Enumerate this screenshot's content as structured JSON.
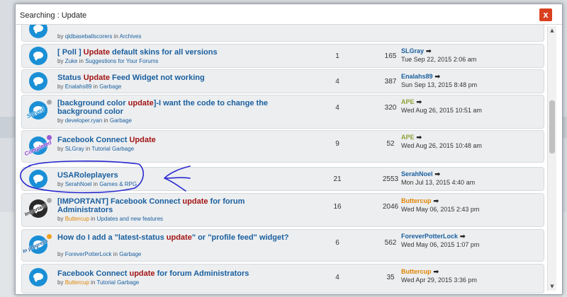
{
  "modal": {
    "title": "Searching : Update",
    "close_label": "x"
  },
  "rows": [
    {
      "title": "",
      "by": "by",
      "author": "qldbaseballscorers",
      "in": "in",
      "forum": "Archives",
      "replies": "",
      "views": "",
      "last_user": "",
      "last_date": ""
    },
    {
      "title_pre": "[ Poll ] ",
      "keyword": "Update",
      "title_post": " default skins for all versions",
      "by": "by",
      "author": "Zuke",
      "in": "in",
      "forum": "Suggestions for Your Forums",
      "replies": "1",
      "views": "165",
      "last_user": "SLGray",
      "last_date": "Tue Sep 22, 2015 2:06 am"
    },
    {
      "title_pre": "Status ",
      "keyword": "Update",
      "title_post": " Feed Widget not working",
      "by": "by",
      "author": "Enalahs89",
      "in": "in",
      "forum": "Garbage",
      "replies": "4",
      "views": "387",
      "last_user": "Enalahs89",
      "last_date": "Sun Sep 13, 2015 8:48 pm"
    },
    {
      "title_pre": "[background color ",
      "keyword": "update",
      "title_post": "]-I want the code to change the background color",
      "by": "by",
      "author": "developer.ryan",
      "in": "in",
      "forum": "Garbage",
      "replies": "4",
      "views": "320",
      "last_user": "APE",
      "last_date": "Wed Aug 26, 2015 10:51 am",
      "tag": "Solved"
    },
    {
      "title_pre": "Facebook Connect ",
      "keyword": "Update",
      "title_post": "",
      "by": "by",
      "author": "SLGray",
      "in": "in",
      "forum": "Tutorial Garbage",
      "replies": "9",
      "views": "52",
      "last_user": "APE",
      "last_date": "Wed Aug 26, 2015 10:48 am",
      "tag": "Completed"
    },
    {
      "title_pre": "USARoleplayers",
      "keyword": "",
      "title_post": "",
      "by": "by",
      "author": "SerahNoel",
      "in": "in",
      "forum": "Games & RPG",
      "replies": "21",
      "views": "2553",
      "last_user": "SerahNoel",
      "last_date": "Mon Jul 13, 2015 4:40 am"
    },
    {
      "title_pre": "[IMPORTANT] Facebook Connect ",
      "keyword": "update",
      "title_post": " for forum Administrators",
      "by": "by",
      "author": "Buttercup",
      "in": "in",
      "forum": "Updates and new features",
      "replies": "16",
      "views": "2046",
      "last_user": "Buttercup",
      "last_date": "Wed May 06, 2015 2:43 pm",
      "tag": "Important"
    },
    {
      "title_pre": "How do I add a \"latest-status ",
      "keyword": "update",
      "title_post": "\" or \"profile feed\" widget?",
      "by": "by",
      "author": "ForeverPotterLock",
      "in": "in",
      "forum": "Garbage",
      "replies": "6",
      "views": "562",
      "last_user": "ForeverPotterLock",
      "last_date": "Wed May 06, 2015 1:07 pm",
      "tag": "In progress"
    },
    {
      "title_pre": "Facebook Connect ",
      "keyword": "update",
      "title_post": " for forum Administrators",
      "by": "by",
      "author": "Buttercup",
      "in": "in",
      "forum": "Tutorial Garbage",
      "replies": "4",
      "views": "35",
      "last_user": "Buttercup",
      "last_date": "Wed Apr 29, 2015 3:36 pm"
    }
  ],
  "colors": {
    "link": "#1a5f9e",
    "keyword": "#a31515",
    "ape": "#8fa33c",
    "orange": "#e08400",
    "annotation": "#2a2ad0"
  }
}
